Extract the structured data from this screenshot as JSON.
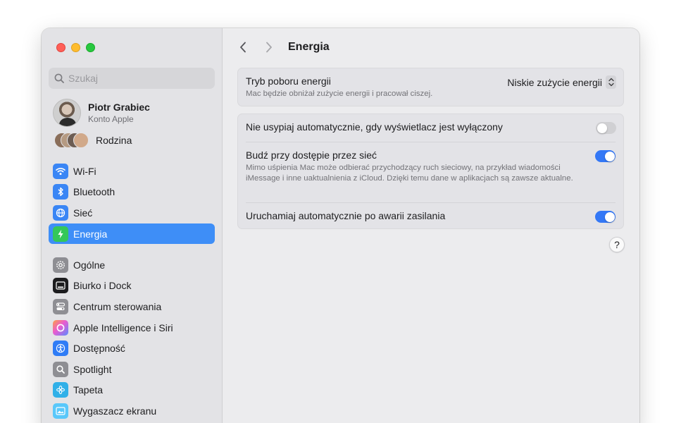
{
  "sidebar": {
    "search_placeholder": "Szukaj",
    "account": {
      "name": "Piotr Grabiec",
      "subtitle": "Konto Apple"
    },
    "family_label": "Rodzina",
    "group1": [
      {
        "label": "Wi-Fi",
        "icon": "wifi-icon",
        "color": "#3a86f5"
      },
      {
        "label": "Bluetooth",
        "icon": "bluetooth-icon",
        "color": "#3a86f5"
      },
      {
        "label": "Sieć",
        "icon": "globe-icon",
        "color": "#3a86f5"
      },
      {
        "label": "Energia",
        "icon": "bolt-icon",
        "color": "#34c759",
        "active": true
      }
    ],
    "group2": [
      {
        "label": "Ogólne",
        "icon": "gear-icon",
        "color": "#8e8e93"
      },
      {
        "label": "Biurko i Dock",
        "icon": "dock-icon",
        "color": "#1c1c1e"
      },
      {
        "label": "Centrum sterowania",
        "icon": "control-center-icon",
        "color": "#8e8e93"
      },
      {
        "label": "Apple Intelligence i Siri",
        "icon": "siri-icon",
        "color": "#c86dd7"
      },
      {
        "label": "Dostępność",
        "icon": "accessibility-icon",
        "color": "#2f7cf6"
      },
      {
        "label": "Spotlight",
        "icon": "magnifier-icon",
        "color": "#8e8e93"
      },
      {
        "label": "Tapeta",
        "icon": "wallpaper-icon",
        "color": "#30b0e8"
      },
      {
        "label": "Wygaszacz ekranu",
        "icon": "screensaver-icon",
        "color": "#5ac8fa"
      }
    ]
  },
  "content": {
    "title": "Energia",
    "power_mode": {
      "title": "Tryb poboru energii",
      "description": "Mac będzie obniżał zużycie energii i pracował ciszej.",
      "value": "Niskie zużycie energii"
    },
    "settings": [
      {
        "title": "Nie usypiaj automatycznie, gdy wyświetlacz jest wyłączony",
        "description": "",
        "enabled": false
      },
      {
        "title": "Budź przy dostępie przez sieć",
        "description": "Mimo uśpienia Mac może odbierać przychodzący ruch sieciowy, na przykład wiadomości iMessage i inne uaktualnienia z iCloud. Dzięki temu dane w aplikacjach są zawsze aktualne.",
        "enabled": true
      },
      {
        "title": "Uruchamiaj automatycznie po awarii zasilania",
        "description": "",
        "enabled": true
      }
    ],
    "help_label": "?"
  }
}
